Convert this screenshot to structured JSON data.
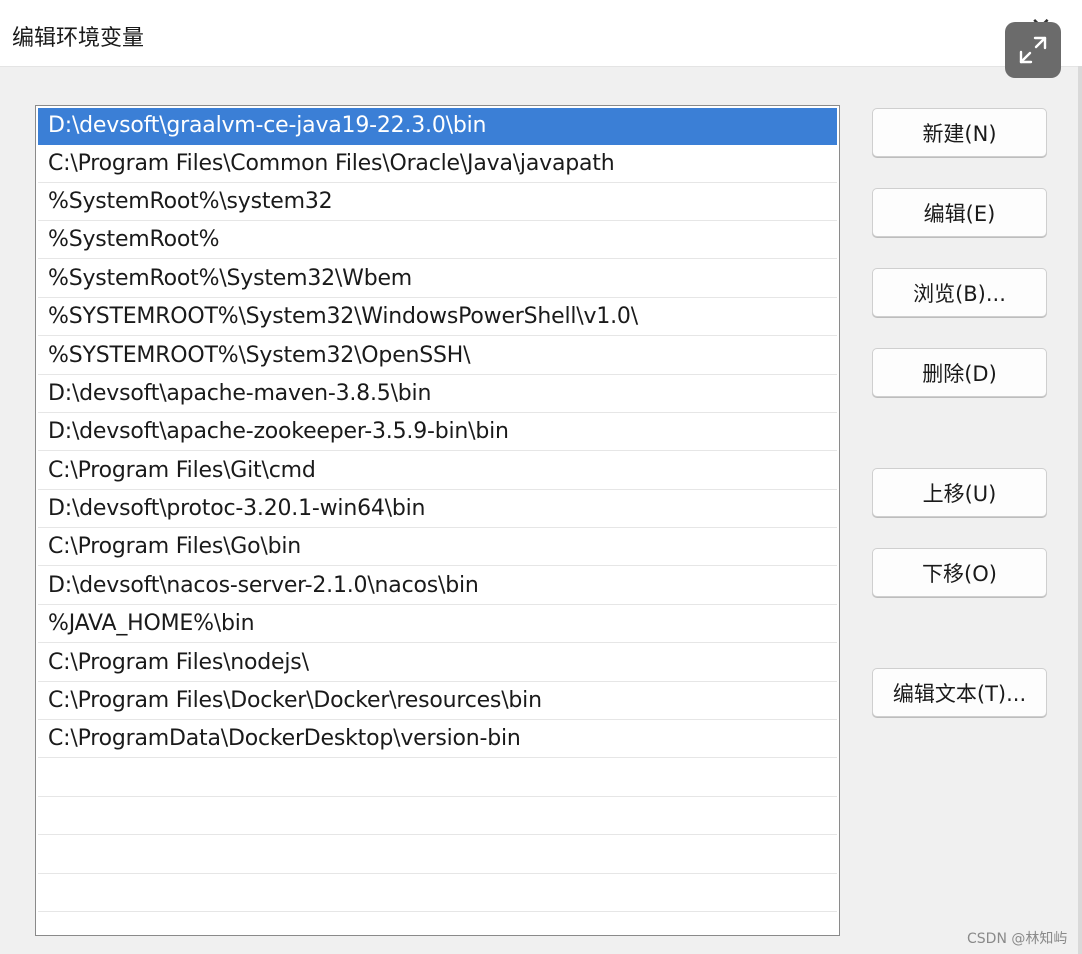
{
  "window": {
    "title": "编辑环境变量",
    "close_glyph": "✕"
  },
  "list": {
    "selected_index": 0,
    "items": [
      "D:\\devsoft\\graalvm-ce-java19-22.3.0\\bin",
      "C:\\Program Files\\Common Files\\Oracle\\Java\\javapath",
      "%SystemRoot%\\system32",
      "%SystemRoot%",
      "%SystemRoot%\\System32\\Wbem",
      "%SYSTEMROOT%\\System32\\WindowsPowerShell\\v1.0\\",
      "%SYSTEMROOT%\\System32\\OpenSSH\\",
      "D:\\devsoft\\apache-maven-3.8.5\\bin",
      "D:\\devsoft\\apache-zookeeper-3.5.9-bin\\bin",
      "C:\\Program Files\\Git\\cmd",
      "D:\\devsoft\\protoc-3.20.1-win64\\bin",
      "C:\\Program Files\\Go\\bin",
      "D:\\devsoft\\nacos-server-2.1.0\\nacos\\bin",
      "%JAVA_HOME%\\bin",
      "C:\\Program Files\\nodejs\\",
      "C:\\Program Files\\Docker\\Docker\\resources\\bin",
      "C:\\ProgramData\\DockerDesktop\\version-bin",
      "",
      "",
      "",
      ""
    ]
  },
  "buttons": {
    "new": "新建(N)",
    "edit": "编辑(E)",
    "browse": "浏览(B)...",
    "delete": "删除(D)",
    "move_up": "上移(U)",
    "move_down": "下移(O)",
    "edit_text": "编辑文本(T)..."
  },
  "watermark": "CSDN @林知屿",
  "icons": {
    "close": "close-icon",
    "expand": "expand-icon"
  },
  "colors": {
    "selection": "#3b7fd6",
    "window_bg": "#f0f0f0"
  }
}
